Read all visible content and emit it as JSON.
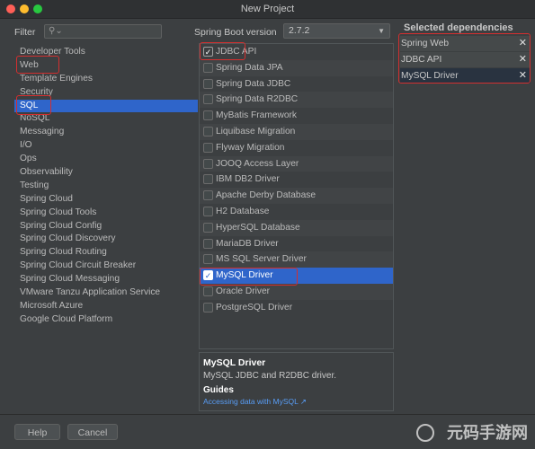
{
  "window": {
    "title": "New Project"
  },
  "filter": {
    "label": "Filter",
    "placeholder": ""
  },
  "spring_boot": {
    "label": "Spring Boot version",
    "value": "2.7.2"
  },
  "categories": [
    "Developer Tools",
    "Web",
    "Template Engines",
    "Security",
    "SQL",
    "NoSQL",
    "Messaging",
    "I/O",
    "Ops",
    "Observability",
    "Testing",
    "Spring Cloud",
    "Spring Cloud Tools",
    "Spring Cloud Config",
    "Spring Cloud Discovery",
    "Spring Cloud Routing",
    "Spring Cloud Circuit Breaker",
    "Spring Cloud Messaging",
    "VMware Tanzu Application Service",
    "Microsoft Azure",
    "Google Cloud Platform"
  ],
  "dependencies": [
    {
      "name": "JDBC API",
      "checked": true
    },
    {
      "name": "Spring Data JPA",
      "checked": false
    },
    {
      "name": "Spring Data JDBC",
      "checked": false
    },
    {
      "name": "Spring Data R2DBC",
      "checked": false
    },
    {
      "name": "MyBatis Framework",
      "checked": false
    },
    {
      "name": "Liquibase Migration",
      "checked": false
    },
    {
      "name": "Flyway Migration",
      "checked": false
    },
    {
      "name": "JOOQ Access Layer",
      "checked": false
    },
    {
      "name": "IBM DB2 Driver",
      "checked": false
    },
    {
      "name": "Apache Derby Database",
      "checked": false
    },
    {
      "name": "H2 Database",
      "checked": false
    },
    {
      "name": "HyperSQL Database",
      "checked": false
    },
    {
      "name": "MariaDB Driver",
      "checked": false
    },
    {
      "name": "MS SQL Server Driver",
      "checked": false
    },
    {
      "name": "MySQL Driver",
      "checked": true
    },
    {
      "name": "Oracle Driver",
      "checked": false
    },
    {
      "name": "PostgreSQL Driver",
      "checked": false
    }
  ],
  "description": {
    "title": "MySQL Driver",
    "text": "MySQL JDBC and R2DBC driver.",
    "guides_label": "Guides",
    "link": "Accessing data with MySQL ↗"
  },
  "selected": {
    "title": "Selected dependencies",
    "items": [
      "Spring Web",
      "JDBC API",
      "MySQL Driver"
    ]
  },
  "buttons": {
    "help": "Help",
    "cancel": "Cancel"
  },
  "watermark": {
    "text": "元码手游网"
  },
  "icons": {
    "search": "search-icon",
    "check": "checkmark-icon",
    "remove": "close-icon",
    "dropdown": "chevron-down-icon"
  },
  "colors": {
    "accent": "#2f65ca",
    "annotation": "#d32f2f",
    "link": "#589df6"
  }
}
